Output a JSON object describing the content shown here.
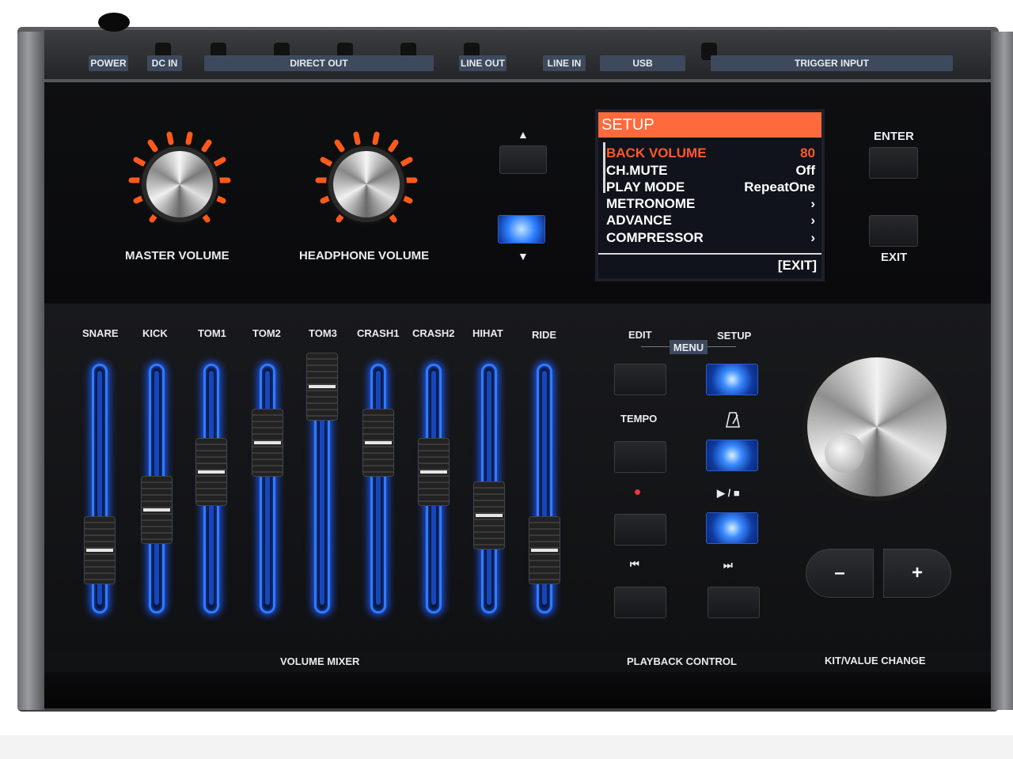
{
  "ports": {
    "power": "POWER",
    "dc_in": "DC IN",
    "direct_out": "DIRECT OUT",
    "line_out": "LINE OUT",
    "line_in": "LINE IN",
    "usb": "USB",
    "trigger_input": "TRIGGER INPUT"
  },
  "knobs": {
    "master": "MASTER VOLUME",
    "headphone": "HEADPHONE VOLUME"
  },
  "nav": {
    "up": "▲",
    "down": "▼"
  },
  "lcd": {
    "title": "SETUP",
    "rows": [
      {
        "label": "BACK VOLUME",
        "value": "80"
      },
      {
        "label": "CH.MUTE",
        "value": "Off"
      },
      {
        "label": "PLAY MODE",
        "value": "RepeatOne"
      },
      {
        "label": "METRONOME",
        "value": "›"
      },
      {
        "label": "ADVANCE",
        "value": "›"
      },
      {
        "label": "COMPRESSOR",
        "value": "›"
      }
    ],
    "exit": "[EXIT]"
  },
  "side_buttons": {
    "enter": "ENTER",
    "exit": "EXIT"
  },
  "mixer": {
    "channels": [
      {
        "name": "SNARE",
        "level": 0.1
      },
      {
        "name": "KICK",
        "level": 0.32
      },
      {
        "name": "TOM1",
        "level": 0.53
      },
      {
        "name": "TOM2",
        "level": 0.69
      },
      {
        "name": "TOM3",
        "level": 1.0
      },
      {
        "name": "CRASH1",
        "level": 0.69
      },
      {
        "name": "CRASH2",
        "level": 0.53
      },
      {
        "name": "HIHAT",
        "level": 0.29
      },
      {
        "name": "RIDE",
        "level": 0.1
      }
    ],
    "section_label": "VOLUME MIXER"
  },
  "playback": {
    "edit": "EDIT",
    "menu": "MENU",
    "setup": "SETUP",
    "tempo": "TEMPO",
    "play_stop": "▶ / ■",
    "prev": "⏮",
    "next": "⏭",
    "section_label": "PLAYBACK CONTROL"
  },
  "kit": {
    "minus": "–",
    "plus": "+",
    "section_label": "KIT/VALUE CHANGE"
  },
  "colors": {
    "led_blue": "#2f7bff",
    "knob_orange": "#ff5a1a",
    "lcd_header": "#ff6a3d",
    "lcd_selected": "#ff5a2a",
    "label_bg": "#3d4a5d"
  }
}
